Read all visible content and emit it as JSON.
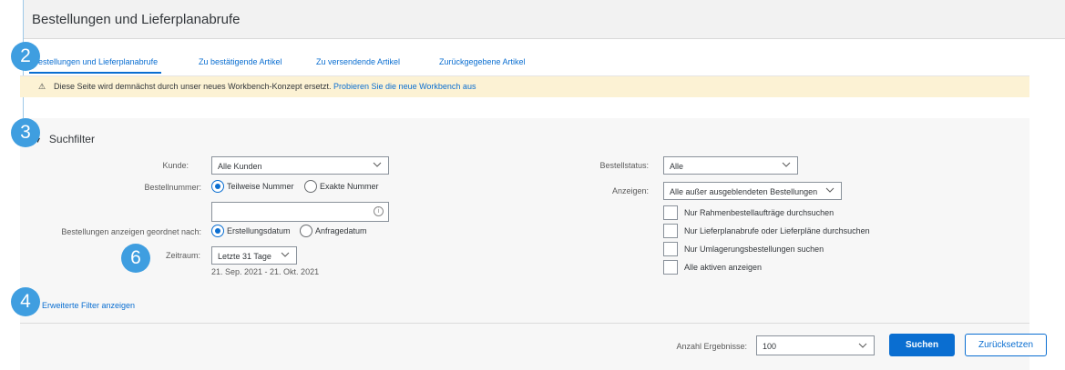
{
  "title": "Bestellungen und Lieferplanabrufe",
  "tabs": [
    {
      "label": "Bestellungen und Lieferplanabrufe",
      "active": true
    },
    {
      "label": "Zu bestätigende Artikel",
      "active": false
    },
    {
      "label": "Zu versendende Artikel",
      "active": false
    },
    {
      "label": "Zurückgegebene Artikel",
      "active": false
    }
  ],
  "notice": {
    "icon": "warning-icon",
    "text": "Diese Seite wird demnächst durch unser neues Workbench-Konzept ersetzt.",
    "link": "Probieren Sie die neue Workbench aus"
  },
  "filter": {
    "heading": "Suchfilter",
    "kunde": {
      "label": "Kunde:",
      "value": "Alle Kunden"
    },
    "bestellnummer": {
      "label": "Bestellnummer:",
      "option_partial": "Teilweise Nummer",
      "option_exact": "Exakte Nummer",
      "selected": "partial",
      "value": ""
    },
    "sort": {
      "label": "Bestellungen anzeigen geordnet nach:",
      "option_created": "Erstellungsdatum",
      "option_request": "Anfragedatum",
      "selected": "created"
    },
    "zeitraum": {
      "label": "Zeitraum:",
      "value": "Letzte 31 Tage",
      "range": "21. Sep. 2021 - 21. Okt. 2021"
    },
    "bestellstatus": {
      "label": "Bestellstatus:",
      "value": "Alle"
    },
    "anzeigen": {
      "label": "Anzeigen:",
      "value": "Alle außer ausgeblendeten Bestellungen"
    },
    "checkboxes": [
      {
        "label": "Nur Rahmenbestellaufträge durchsuchen",
        "checked": false
      },
      {
        "label": "Nur Lieferplanabrufe oder Lieferpläne durchsuchen",
        "checked": false
      },
      {
        "label": "Nur Umlagerungsbestellungen suchen",
        "checked": false
      },
      {
        "label": "Alle aktiven anzeigen",
        "checked": false
      }
    ],
    "advanced_link": "Erweiterte Filter anzeigen"
  },
  "footer": {
    "results_label": "Anzahl Ergebnisse:",
    "results_value": "100",
    "search_button": "Suchen",
    "reset_button": "Zurücksetzen"
  },
  "badges": [
    "2",
    "3",
    "4",
    "6"
  ],
  "colors": {
    "accent": "#0a6ed1",
    "badge": "#3f9ee0",
    "notice_bg": "#fcf2d4"
  }
}
